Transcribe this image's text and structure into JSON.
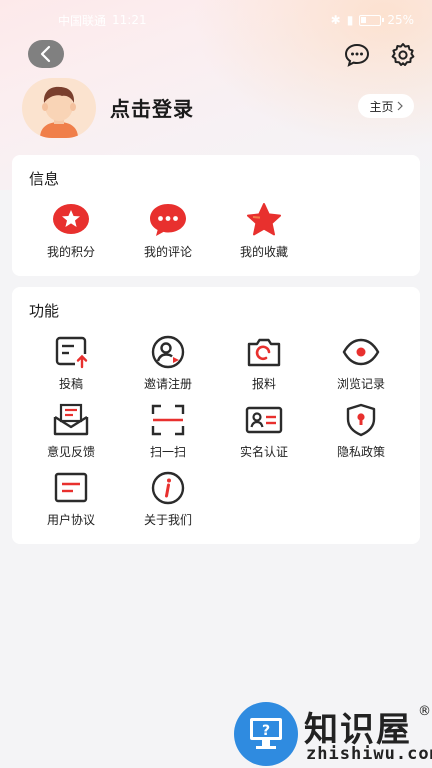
{
  "status_bar": {
    "carrier": "中国联通",
    "time": "11:21",
    "battery": "25%"
  },
  "header": {
    "back_icon": "chevron-left-icon",
    "message_icon": "chat-bubble-icon",
    "settings_icon": "gear-icon"
  },
  "profile": {
    "login_text": "点击登录",
    "home_label": "主页"
  },
  "info_section": {
    "title": "信息",
    "items": [
      {
        "label": "我的积分",
        "icon": "points-star-icon"
      },
      {
        "label": "我的评论",
        "icon": "comment-bubble-icon"
      },
      {
        "label": "我的收藏",
        "icon": "favorite-star-icon"
      }
    ]
  },
  "function_section": {
    "title": "功能",
    "items": [
      {
        "label": "投稿",
        "icon": "submit-article-icon"
      },
      {
        "label": "邀请注册",
        "icon": "invite-user-icon"
      },
      {
        "label": "报料",
        "icon": "camera-icon"
      },
      {
        "label": "浏览记录",
        "icon": "eye-icon"
      },
      {
        "label": "意见反馈",
        "icon": "feedback-mail-icon"
      },
      {
        "label": "扫一扫",
        "icon": "scan-icon"
      },
      {
        "label": "实名认证",
        "icon": "id-card-icon"
      },
      {
        "label": "隐私政策",
        "icon": "privacy-shield-icon"
      },
      {
        "label": "用户协议",
        "icon": "agreement-doc-icon"
      },
      {
        "label": "关于我们",
        "icon": "info-icon"
      }
    ]
  },
  "watermark": {
    "title": "知识屋",
    "url": "zhishiwu.com",
    "reg": "®"
  },
  "colors": {
    "accent": "#e8302e",
    "dark_stroke": "#2b2b2b",
    "page_bg": "#f4f4f6"
  }
}
